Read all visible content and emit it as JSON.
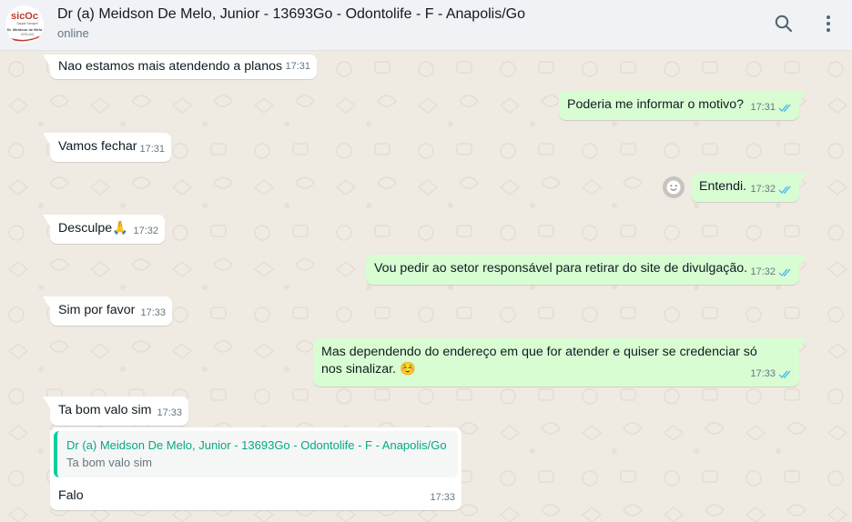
{
  "header": {
    "title": "Dr (a) Meidson De Melo, Junior - 13693Go - Odontolife - F - Anapolis/Go",
    "status": "online",
    "avatar": {
      "brand": "sicOc",
      "line1": "Saúde Sempre",
      "line2": "Dr. Meidson de Melo",
      "line3": "CRO-GO"
    },
    "icons": [
      "search-icon",
      "menu-kebab-icon"
    ]
  },
  "messages": [
    {
      "dir": "in",
      "text": "Nao estamos mais atendendo a planos",
      "time": "17:31"
    },
    {
      "dir": "out",
      "text": "Poderia me informar o motivo?",
      "time": "17:31",
      "status": "read"
    },
    {
      "dir": "in",
      "text": "Vamos fechar",
      "time": "17:31"
    },
    {
      "dir": "out",
      "text": "Entendi.",
      "time": "17:32",
      "status": "read"
    },
    {
      "dir": "in",
      "text": "Desculpe",
      "emoji": "🙏",
      "time": "17:32"
    },
    {
      "dir": "out",
      "text": "Vou pedir ao setor responsável para retirar do site de divulgação.",
      "time": "17:32",
      "status": "read"
    },
    {
      "dir": "in",
      "text": "Sim por favor",
      "time": "17:33"
    },
    {
      "dir": "out",
      "text": "Mas dependendo do endereço em que for atender e quiser se credenciar só nos sinalizar.",
      "emoji": "☺️",
      "time": "17:33",
      "status": "read"
    },
    {
      "dir": "in",
      "text": "Ta bom valo sim",
      "time": "17:33"
    },
    {
      "dir": "in",
      "text": "Falo",
      "time": "17:33",
      "quote": {
        "author": "Dr (a) Meidson De Melo, Junior - 13693Go - Odontolife - F - Anapolis/Go",
        "text": "Ta bom valo sim"
      }
    }
  ],
  "colors": {
    "incoming": "#ffffff",
    "outgoing": "#d9fdd3",
    "read_ticks": "#53bdeb",
    "quote_accent": "#06cf9c",
    "background": "#efeae2"
  }
}
